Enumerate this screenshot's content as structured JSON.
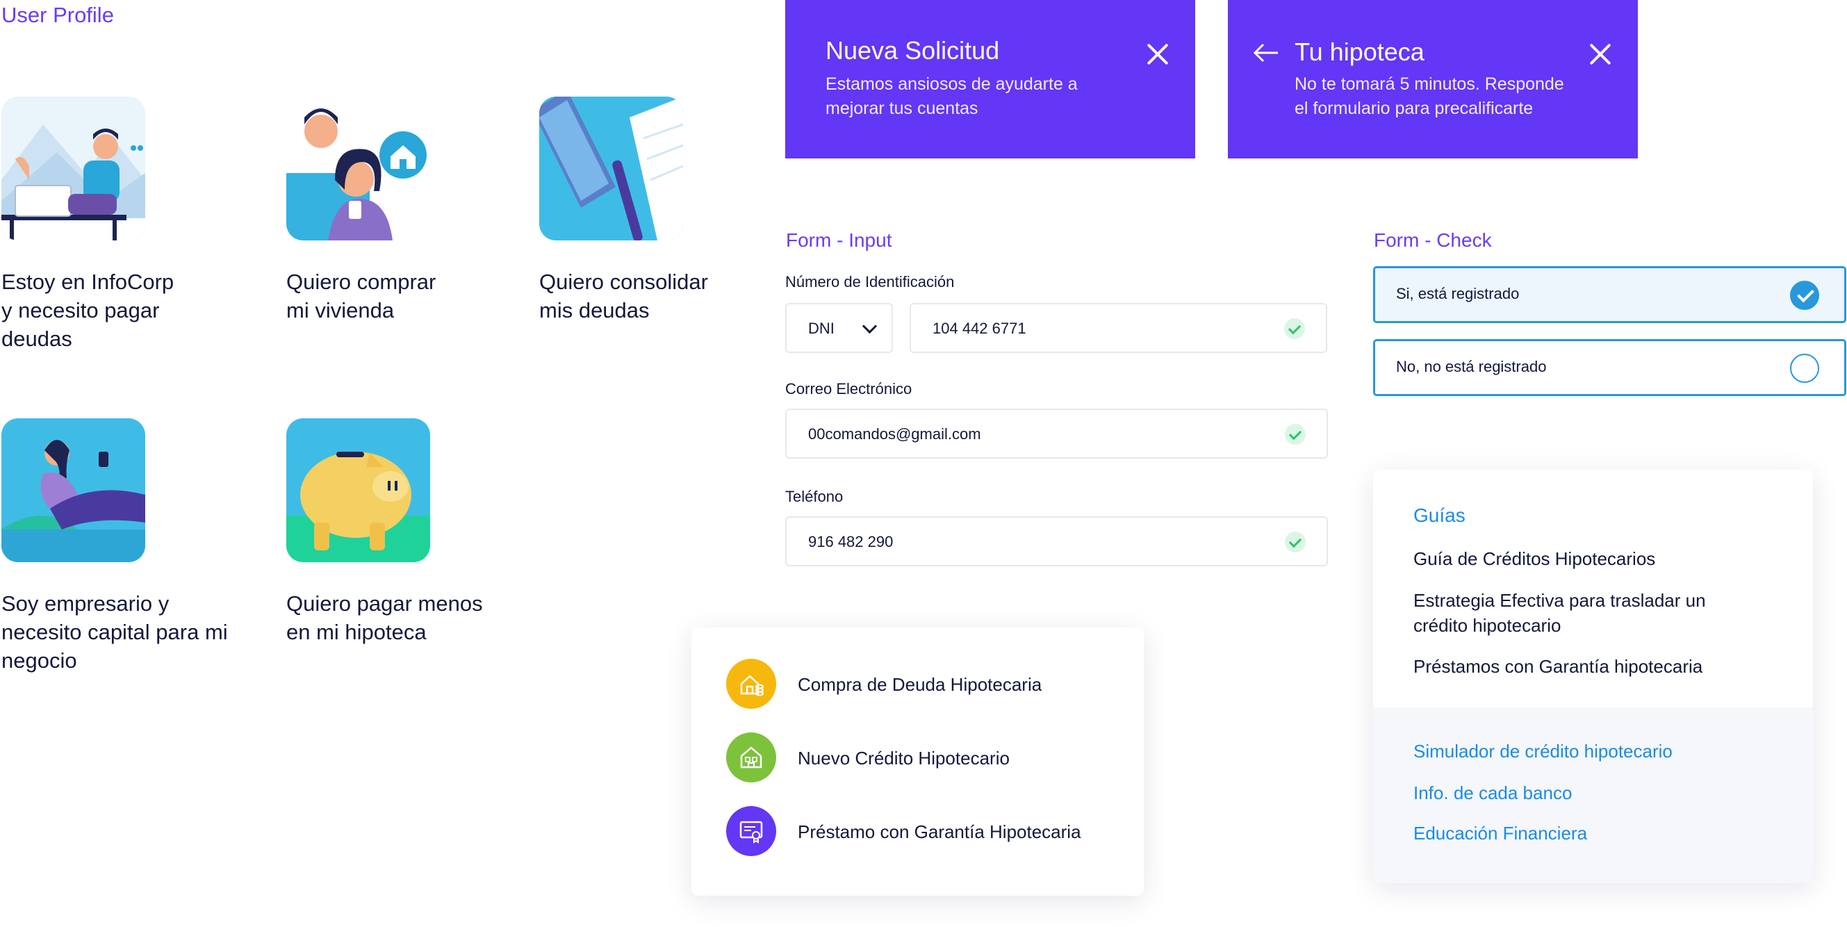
{
  "profile": {
    "title": "User Profile",
    "cards": [
      {
        "label": "Estoy en InfoCorp\ny necesito pagar\ndeudas",
        "illustration": "person-at-desk"
      },
      {
        "label": "Quiero comprar\nmi vivienda",
        "illustration": "couple-house"
      },
      {
        "label": "Quiero consolidar\nmis deudas",
        "illustration": "phone-pen-notebook"
      },
      {
        "label": "Soy empresario y\nnecesito capital para mi\nnegocio",
        "illustration": "woman-relaxing"
      },
      {
        "label": "Quiero pagar menos\nen mi hipoteca",
        "illustration": "piggy-bank"
      }
    ]
  },
  "banners": {
    "nueva": {
      "title": "Nueva Solicitud",
      "subtitle": "Estamos ansiosos de ayudarte a\nmejorar tus cuentas",
      "icon": "close-icon"
    },
    "hipoteca": {
      "title": "Tu hipoteca",
      "subtitle": "No te tomará 5 minutos. Responde\nel formulario para precalificarte",
      "icons": [
        "arrow-left-icon",
        "close-icon"
      ]
    }
  },
  "form_input": {
    "title": "Form - Input",
    "id_label": "Número de Identificación",
    "id_type": "DNI",
    "id_value": "104 442 6771",
    "email_label": "Correo Electrónico",
    "email_value": "00comandos@gmail.com",
    "phone_label": "Teléfono",
    "phone_value": "916 482 290"
  },
  "form_check": {
    "title": "Form - Check",
    "options": [
      {
        "label": "Si, está registrado",
        "selected": true
      },
      {
        "label": "No, no está registrado",
        "selected": false
      }
    ]
  },
  "menu": {
    "items": [
      {
        "label": "Compra de Deuda Hipotecaria",
        "color": "#f6b80c",
        "icon": "house-coins-icon"
      },
      {
        "label": "Nuevo Crédito Hipotecario",
        "color": "#7cc23a",
        "icon": "house-icon"
      },
      {
        "label": "Préstamo con Garantía Hipotecaria",
        "color": "#6436f5",
        "icon": "certificate-icon"
      }
    ]
  },
  "guides": {
    "title": "Guías",
    "items": [
      "Guía de Créditos Hipotecarios",
      "Estrategia Efectiva para trasladar un\ncrédito hipotecario",
      "Préstamos con Garantía hipotecaria"
    ],
    "links": [
      "Simulador de crédito hipotecario",
      "Info. de cada banco",
      "Educación Financiera"
    ]
  },
  "colors": {
    "primary": "#6436f5",
    "accent_blue": "#2798dc",
    "link_blue": "#1a8be6",
    "success": "#2fc26c"
  }
}
